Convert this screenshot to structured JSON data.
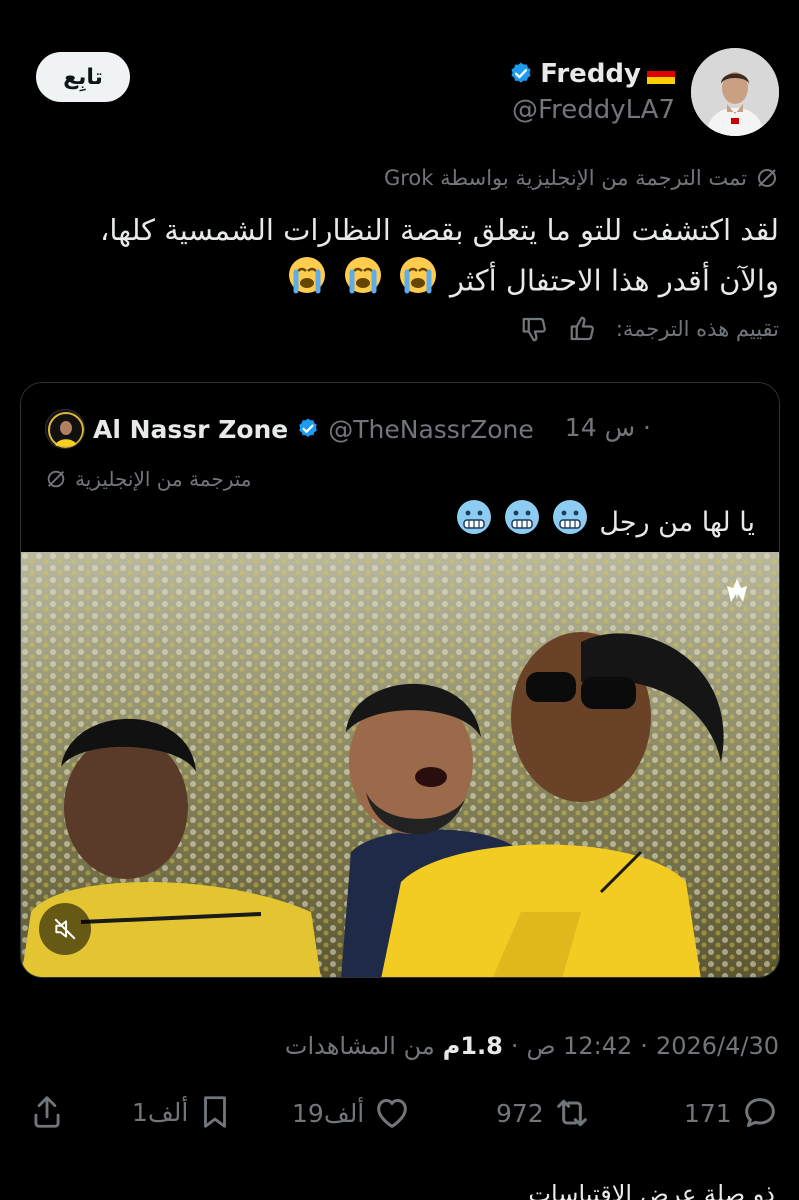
{
  "header": {
    "follow_label": "تابِع",
    "display_name": "Freddy",
    "flag": "🇩🇪",
    "handle": "@FreddyLA7"
  },
  "tweet": {
    "translated_by": "تمت الترجمة من الإنجليزية بواسطة Grok",
    "text_line1": "لقد اكتشفت للتو ما يتعلق بقصة النظارات الشمسية كلها،",
    "text_line2": "والآن أقدر هذا الاحتفال أكثر",
    "rate_label": "تقييم هذه الترجمة:"
  },
  "quote": {
    "name": "Al Nassr Zone",
    "handle": "@TheNassrZone",
    "time": "14 س ·",
    "translated": "مترجمة من الإنجليزية",
    "text": "يا لها من رجل"
  },
  "meta": {
    "date": "2026/4/30",
    "time": "12:42 ص",
    "views_num": "1.8م",
    "views_label": "من المشاهدات"
  },
  "actions": {
    "replies": "171",
    "reposts": "972",
    "likes": "19ألف",
    "bookmarks": "1ألف"
  },
  "bottom_text": "ذو صلة عرض الاقتباسات",
  "colors": {
    "background": "#000000",
    "text": "#e7e9ea",
    "muted": "#71767b",
    "verified": "#1d9bf0",
    "border": "#2f3336"
  }
}
